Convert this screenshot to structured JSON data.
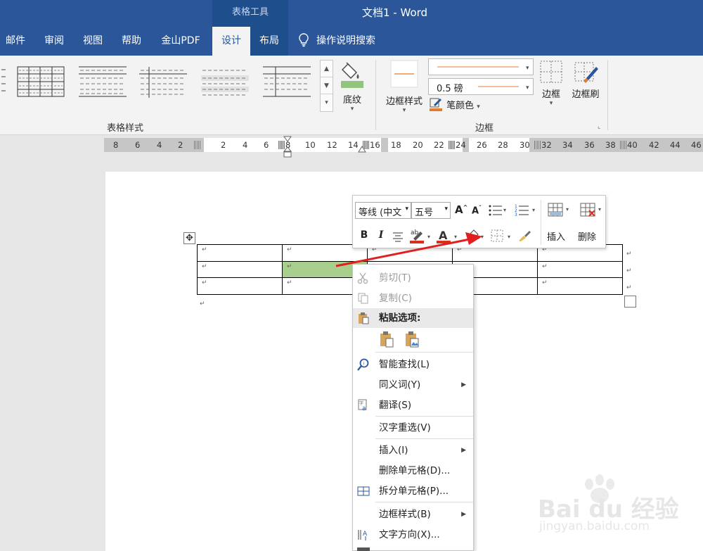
{
  "window": {
    "context_group": "表格工具",
    "title": "文档1  -  Word"
  },
  "tabs": [
    {
      "label": "邮件"
    },
    {
      "label": "审阅"
    },
    {
      "label": "视图"
    },
    {
      "label": "帮助"
    },
    {
      "label": "金山PDF"
    },
    {
      "label": "设计"
    },
    {
      "label": "布局"
    }
  ],
  "tell_me": "操作说明搜索",
  "ribbon": {
    "shading_label": "底纹",
    "table_styles_group": "表格样式",
    "border_styles_label": "边框样式",
    "line_weight": "0.5 磅",
    "pen_color_label": "笔颜色",
    "borders_label": "边框",
    "border_painter_label": "边框刷",
    "borders_group": "边框",
    "accent_orange": "#e77b2c",
    "shading_green": "#92c47d"
  },
  "ruler": {
    "left_numbers": [
      "8",
      "6",
      "4",
      "2"
    ],
    "numbers": [
      "2",
      "4",
      "6",
      "8",
      "10",
      "12",
      "14",
      "16",
      "18",
      "20",
      "22",
      "24",
      "26",
      "28",
      "30",
      "32",
      "34",
      "36",
      "38",
      "40",
      "42",
      "44",
      "46"
    ]
  },
  "table": {
    "rows": [
      [
        "↵",
        "↵",
        "↵",
        "↵",
        "↵"
      ],
      [
        "↵",
        "↵",
        "↵",
        "↵",
        "↵"
      ],
      [
        "↵",
        "↵",
        "↵",
        "↵",
        "↵"
      ]
    ],
    "row_end_mark": "↵",
    "para_mark": "↵",
    "selected_color": "#a9cf8e"
  },
  "mini_toolbar": {
    "font_name": "等线 (中文",
    "font_size": "五号",
    "insert_label": "插入",
    "delete_label": "删除"
  },
  "context_menu": {
    "items": [
      {
        "label": "剪切(T)",
        "icon": "scissors-icon",
        "disabled": true
      },
      {
        "label": "复制(C)",
        "icon": "copy-icon",
        "disabled": true
      },
      {
        "label": "粘贴选项:",
        "icon": "clipboard-icon"
      },
      {
        "label": "智能查找(L)",
        "icon": "smart-lookup-icon"
      },
      {
        "label": "同义词(Y)",
        "submenu": true
      },
      {
        "label": "翻译(S)",
        "icon": "translate-icon"
      },
      {
        "label": "汉字重选(V)"
      },
      {
        "label": "插入(I)",
        "submenu": true
      },
      {
        "label": "删除单元格(D)..."
      },
      {
        "label": "拆分单元格(P)...",
        "icon": "split-cells-icon"
      },
      {
        "label": "边框样式(B)",
        "submenu": true
      },
      {
        "label": "文字方向(X)...",
        "icon": "text-direction-icon"
      }
    ]
  },
  "watermark": {
    "brand": "Bai du 经验",
    "url": "jingyan.baidu.com"
  }
}
